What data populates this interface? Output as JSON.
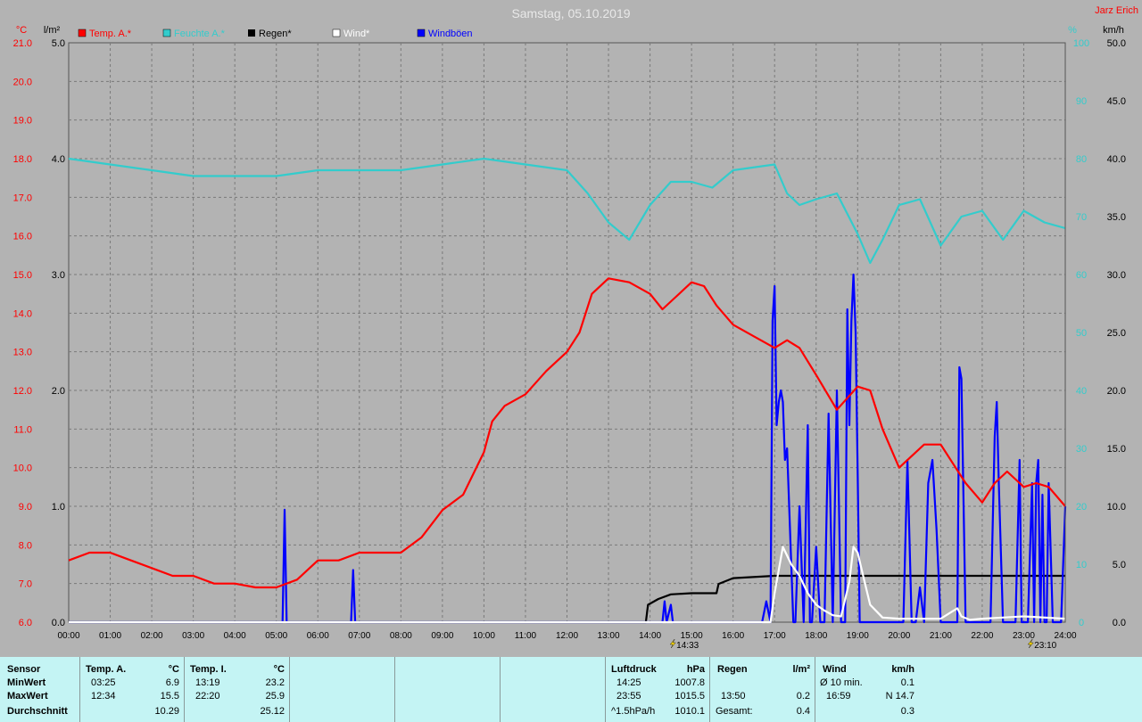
{
  "title": "Samstag, 05.10.2019",
  "author": "Jarz Erich",
  "colors": {
    "temp": "#ff0000",
    "humidity": "#33cccc",
    "rain": "#000000",
    "wind": "#ffffff",
    "gusts": "#0000ff",
    "grid": "#7a7a7a",
    "bg": "#b3b3b3",
    "stats_bg": "#c4f4f4"
  },
  "axes": {
    "temp_unit": "°C",
    "rain_unit": "l/m²",
    "humidity_unit": "%",
    "wind_unit": "km/h",
    "temp_ticks": [
      "21.0",
      "20.0",
      "19.0",
      "18.0",
      "17.0",
      "16.0",
      "15.0",
      "14.0",
      "13.0",
      "12.0",
      "11.0",
      "10.0",
      "9.0",
      "8.0",
      "7.0",
      "6.0"
    ],
    "rain_ticks": [
      "5.0",
      "4.0",
      "3.0",
      "2.0",
      "1.0",
      "0.0"
    ],
    "humidity_ticks": [
      "100",
      "90",
      "80",
      "70",
      "60",
      "50",
      "40",
      "30",
      "20",
      "10",
      "0"
    ],
    "wind_ticks": [
      "50.0",
      "45.0",
      "40.0",
      "35.0",
      "30.0",
      "25.0",
      "20.0",
      "15.0",
      "10.0",
      "5.0",
      "0.0"
    ],
    "time_ticks": [
      "00:00",
      "01:00",
      "02:00",
      "03:00",
      "04:00",
      "05:00",
      "06:00",
      "07:00",
      "08:00",
      "09:00",
      "10:00",
      "11:00",
      "12:00",
      "13:00",
      "14:00",
      "15:00",
      "16:00",
      "17:00",
      "18:00",
      "19:00",
      "20:00",
      "21:00",
      "22:00",
      "23:00",
      "24:00"
    ],
    "sun_marks": [
      "14:33",
      "23:10"
    ]
  },
  "chart_data": {
    "type": "line",
    "title": "Samstag, 05.10.2019",
    "xlabel": "",
    "x_range": [
      "00:00",
      "24:00"
    ],
    "grid": true,
    "legend_position": "top",
    "series": [
      {
        "name": "Temp. A.*",
        "axis": "temp",
        "ylim": [
          6,
          21
        ],
        "x": [
          0,
          0.5,
          1,
          1.5,
          2,
          2.5,
          3,
          3.5,
          4,
          4.5,
          5,
          5.5,
          6,
          6.5,
          7,
          7.5,
          8,
          8.5,
          9,
          9.5,
          10,
          10.2,
          10.5,
          11,
          11.5,
          12,
          12.3,
          12.6,
          13,
          13.5,
          14,
          14.3,
          14.6,
          15,
          15.3,
          15.6,
          16,
          16.5,
          17,
          17.3,
          17.6,
          18,
          18.5,
          19,
          19.3,
          19.6,
          20,
          20.3,
          20.6,
          21,
          21.3,
          21.6,
          22,
          22.3,
          22.6,
          23,
          23.3,
          23.6,
          24
        ],
        "y": [
          7.6,
          7.8,
          7.8,
          7.6,
          7.4,
          7.2,
          7.2,
          7.0,
          7.0,
          6.9,
          6.9,
          7.1,
          7.6,
          7.6,
          7.8,
          7.8,
          7.8,
          8.2,
          8.9,
          9.3,
          10.4,
          11.2,
          11.6,
          11.9,
          12.5,
          13.0,
          13.5,
          14.5,
          14.9,
          14.8,
          14.5,
          14.1,
          14.4,
          14.8,
          14.7,
          14.2,
          13.7,
          13.4,
          13.1,
          13.3,
          13.1,
          12.4,
          11.5,
          12.1,
          12.0,
          11.0,
          10.0,
          10.3,
          10.6,
          10.6,
          10.1,
          9.6,
          9.1,
          9.6,
          9.9,
          9.5,
          9.6,
          9.5,
          9.0
        ]
      },
      {
        "name": "Feuchte A.*",
        "axis": "humidity",
        "ylim": [
          0,
          100
        ],
        "x": [
          0,
          1,
          2,
          3,
          4,
          5,
          6,
          7,
          8,
          9,
          10,
          11,
          12,
          12.5,
          13,
          13.5,
          14,
          14.5,
          15,
          15.5,
          16,
          17,
          17.3,
          17.6,
          18,
          18.5,
          19,
          19.3,
          19.6,
          20,
          20.5,
          21,
          21.5,
          22,
          22.5,
          23,
          23.5,
          24
        ],
        "y": [
          80,
          79,
          78,
          77,
          77,
          77,
          78,
          78,
          78,
          79,
          80,
          79,
          78,
          74,
          69,
          66,
          72,
          76,
          76,
          75,
          78,
          79,
          74,
          72,
          73,
          74,
          67,
          62,
          66,
          72,
          73,
          65,
          70,
          71,
          66,
          71,
          69,
          68
        ]
      },
      {
        "name": "Regen*",
        "axis": "rain",
        "ylim": [
          0,
          5
        ],
        "x": [
          0,
          13.9,
          13.95,
          14.2,
          14.5,
          15,
          15.6,
          15.65,
          16,
          17,
          24
        ],
        "y": [
          0,
          0,
          0.15,
          0.2,
          0.24,
          0.25,
          0.25,
          0.33,
          0.38,
          0.4,
          0.4
        ]
      },
      {
        "name": "Wind*",
        "axis": "wind",
        "ylim": [
          0,
          50
        ],
        "x": [
          0,
          16.9,
          17.0,
          17.2,
          17.4,
          17.6,
          17.8,
          18.0,
          18.2,
          18.4,
          18.6,
          18.8,
          18.9,
          19.0,
          19.1,
          19.3,
          19.6,
          20.0,
          21.0,
          21.4,
          21.5,
          21.7,
          22.0,
          23.0,
          24
        ],
        "y": [
          0,
          0,
          2.5,
          6.5,
          5.0,
          4.0,
          2.5,
          1.5,
          1.0,
          0.6,
          0.5,
          3.5,
          6.5,
          6.0,
          4.5,
          1.5,
          0.4,
          0.3,
          0.3,
          1.2,
          0.5,
          0.2,
          0.3,
          0.5,
          0.3
        ]
      },
      {
        "name": "Windböen",
        "axis": "wind",
        "ylim": [
          0,
          50
        ],
        "x": [
          0,
          5.15,
          5.2,
          5.25,
          5.3,
          6.8,
          6.85,
          6.9,
          14.3,
          14.35,
          14.4,
          14.5,
          14.55,
          14.6,
          16.7,
          16.8,
          16.9,
          16.95,
          17.0,
          17.05,
          17.1,
          17.15,
          17.2,
          17.25,
          17.3,
          17.45,
          17.5,
          17.6,
          17.7,
          17.8,
          17.85,
          17.9,
          18.0,
          18.1,
          18.15,
          18.2,
          18.3,
          18.4,
          18.5,
          18.6,
          18.7,
          18.75,
          18.8,
          18.85,
          18.9,
          18.95,
          19.0,
          19.05,
          19.1,
          19.2,
          19.3,
          19.6,
          19.9,
          20.1,
          20.2,
          20.3,
          20.4,
          20.5,
          20.6,
          20.7,
          20.8,
          20.9,
          21.0,
          21.3,
          21.4,
          21.45,
          21.5,
          21.6,
          21.7,
          22.0,
          22.2,
          22.3,
          22.35,
          22.4,
          22.5,
          22.8,
          22.9,
          22.95,
          23.0,
          23.1,
          23.2,
          23.25,
          23.3,
          23.35,
          23.4,
          23.45,
          23.5,
          23.55,
          23.6,
          23.7,
          23.8,
          23.9,
          24
        ],
        "y": [
          0,
          0,
          9.7,
          0,
          0,
          0,
          4.5,
          0,
          0,
          1.8,
          0,
          1.5,
          0,
          0,
          0,
          1.8,
          0,
          26,
          29,
          17,
          19,
          20,
          19,
          14,
          15,
          0,
          0,
          10,
          0,
          17,
          0,
          0,
          6.5,
          0,
          0,
          0,
          18,
          0,
          20,
          0,
          0,
          27,
          17,
          26,
          30,
          25,
          13,
          0,
          0,
          0,
          0,
          0,
          0,
          0,
          14,
          0,
          0,
          3,
          0,
          12,
          14,
          8,
          0,
          0,
          0,
          22,
          21,
          0,
          0,
          0,
          0,
          16,
          19,
          12,
          0,
          0,
          14,
          0,
          0,
          0,
          12,
          0,
          12,
          14,
          0,
          11,
          0,
          0,
          12,
          0,
          0,
          0,
          10
        ]
      }
    ],
    "min_max_marker": "Temp. A. min 6.9 at 03:25"
  },
  "stats": {
    "sensor_label": "Sensor",
    "row_min": "MinWert",
    "row_max": "MaxWert",
    "row_avg": "Durchschnitt",
    "temp_a": {
      "header": "Temp. A.",
      "unit": "°C",
      "min_time": "03:25",
      "min": "6.9",
      "max_time": "12:34",
      "max": "15.5",
      "avg": "10.29"
    },
    "temp_i": {
      "header": "Temp. I.",
      "unit": "°C",
      "min_time": "13:19",
      "min": "23.2",
      "max_time": "22:20",
      "max": "25.9",
      "avg": "25.12"
    },
    "pressure": {
      "header": "Luftdruck",
      "unit": "hPa",
      "min_time": "14:25",
      "min": "1007.8",
      "max_time": "23:55",
      "max": "1015.5",
      "trend_label": "^1.5hPa/h",
      "avg": "1010.1"
    },
    "rain": {
      "header": "Regen",
      "unit": "l/m²",
      "max_time": "13:50",
      "max": "0.2",
      "total_label": "Gesamt:",
      "total": "0.4"
    },
    "wind": {
      "header": "Wind",
      "unit": "km/h",
      "min_label": "Ø 10 min.",
      "min": "0.1",
      "max_time": "16:59",
      "max": "N 14.7",
      "avg": "0.3"
    }
  }
}
